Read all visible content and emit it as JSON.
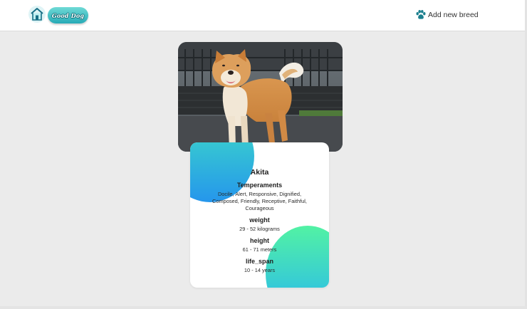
{
  "navbar": {
    "brand_text": "Good Dog",
    "add_breed_label": "Add new breed",
    "home_icon": "house-icon",
    "paw_icon": "paw-icon"
  },
  "breed": {
    "name": "Akita",
    "temperaments_title": "Temperaments",
    "temperaments": "Docile, Alert, Responsive, Dignified, Composed, Friendly, Receptive, Faithful, Courageous",
    "weight_title": "weight",
    "weight": "29 - 52 kilograms",
    "height_title": "height",
    "height": "61 - 71 meters",
    "life_span_title": "life_span",
    "life_span": "10 - 14 years"
  },
  "colors": {
    "accent_teal": "#27aab6",
    "blob_top": [
      "#3fe0c4",
      "#2596ec"
    ],
    "blob_bottom": [
      "#52f2a4",
      "#3ab6e4"
    ],
    "background": "#ebebeb"
  }
}
